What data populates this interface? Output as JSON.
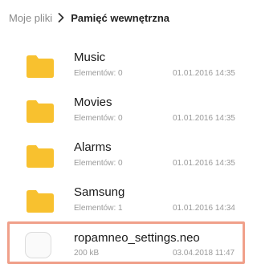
{
  "breadcrumb": {
    "root": "Moje pliki",
    "current": "Pamięć wewnętrzna"
  },
  "items": [
    {
      "name": "Music",
      "meta": "Elementów: 0",
      "date": "01.01.2016 14:35",
      "icon": "folder-icon"
    },
    {
      "name": "Movies",
      "meta": "Elementów: 0",
      "date": "01.01.2016 14:35",
      "icon": "folder-icon"
    },
    {
      "name": "Alarms",
      "meta": "Elementów: 0",
      "date": "01.01.2016 14:35",
      "icon": "folder-icon"
    },
    {
      "name": "Samsung",
      "meta": "Elementów: 1",
      "date": "01.01.2016 14:34",
      "icon": "folder-icon"
    }
  ],
  "file": {
    "name": "ropamneo_settings.neo",
    "meta": "200 kB",
    "date": "03.04.2018 11:47",
    "icon": "file-icon"
  },
  "colors": {
    "folder": "#f8c12f",
    "highlight": "#f0a08a"
  }
}
